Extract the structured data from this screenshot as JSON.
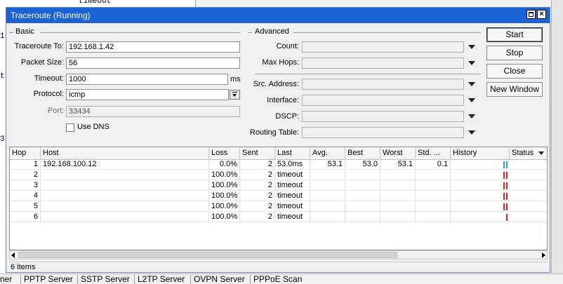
{
  "background": {
    "line1": "timeout",
    "left_chars": [
      "1",
      "t",
      "3r"
    ]
  },
  "window": {
    "title": "Traceroute (Running)",
    "close_glyph": "×"
  },
  "basic": {
    "title": "Basic",
    "traceroute_to_label": "Traceroute To:",
    "traceroute_to_value": "192.168.1.42",
    "packet_size_label": "Packet Size:",
    "packet_size_value": "56",
    "timeout_label": "Timeout:",
    "timeout_value": "1000",
    "timeout_unit": "ms",
    "protocol_label": "Protocol:",
    "protocol_value": "icmp",
    "port_label": "Port:",
    "port_value": "33434",
    "use_dns_label": "Use DNS"
  },
  "advanced": {
    "title": "Advanced",
    "count_label": "Count:",
    "max_hops_label": "Max Hops:",
    "src_address_label": "Src. Address:",
    "interface_label": "Interface:",
    "dscp_label": "DSCP:",
    "routing_table_label": "Routing Table:"
  },
  "buttons": {
    "start": "Start",
    "stop": "Stop",
    "close": "Close",
    "new_window": "New Window"
  },
  "table": {
    "columns": [
      "Hop",
      "Host",
      "Loss",
      "Sent",
      "Last",
      "Avg.",
      "Best",
      "Worst",
      "Std. ...",
      "History",
      "Status"
    ],
    "rows": [
      {
        "hop": "1",
        "host": "192.168.100.12",
        "loss": "0.0%",
        "sent": "2",
        "last": "53.0ms",
        "avg": "53.1",
        "best": "53.0",
        "worst": "53.1",
        "std": "0.1",
        "history": "ok"
      },
      {
        "hop": "2",
        "host": "",
        "loss": "100.0%",
        "sent": "2",
        "last": "timeout",
        "avg": "",
        "best": "",
        "worst": "",
        "std": "",
        "history": "timeout"
      },
      {
        "hop": "3",
        "host": "",
        "loss": "100.0%",
        "sent": "2",
        "last": "timeout",
        "avg": "",
        "best": "",
        "worst": "",
        "std": "",
        "history": "timeout"
      },
      {
        "hop": "4",
        "host": "",
        "loss": "100.0%",
        "sent": "2",
        "last": "timeout",
        "avg": "",
        "best": "",
        "worst": "",
        "std": "",
        "history": "timeout"
      },
      {
        "hop": "5",
        "host": "",
        "loss": "100.0%",
        "sent": "2",
        "last": "timeout",
        "avg": "",
        "best": "",
        "worst": "",
        "std": "",
        "history": "timeout"
      },
      {
        "hop": "6",
        "host": "",
        "loss": "100.0%",
        "sent": "2",
        "last": "timeout",
        "avg": "",
        "best": "",
        "worst": "",
        "std": "",
        "history": "timeout-single"
      }
    ],
    "history_colors": {
      "ok": "#2fa3c4",
      "timeout": "#e02020"
    }
  },
  "status_bar": {
    "items_count": "6 items"
  },
  "taskbar": {
    "tabs": [
      "ner",
      "PPTP Server",
      "SSTP Server",
      "L2TP Server",
      "OVPN Server",
      "PPPoE Scan"
    ]
  }
}
